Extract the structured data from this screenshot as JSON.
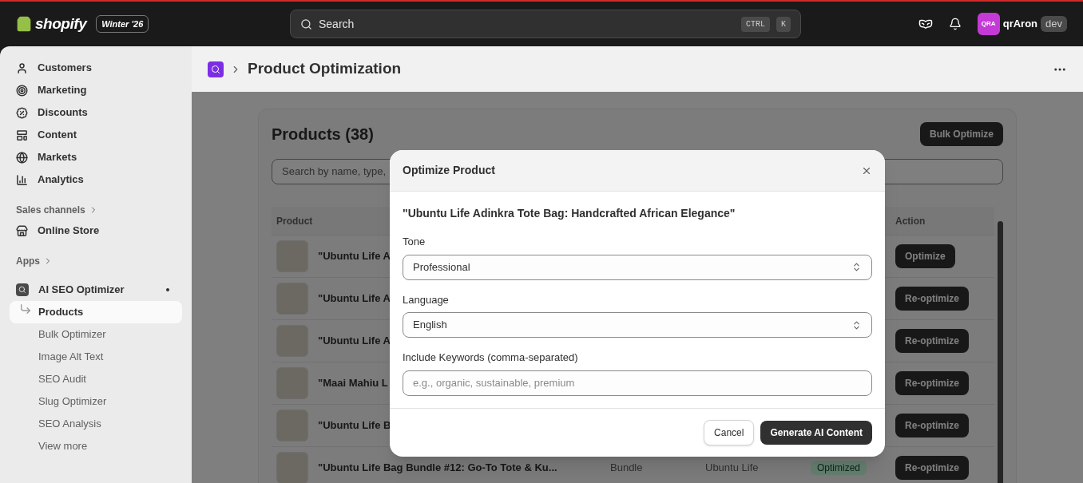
{
  "topbar": {
    "brand": "shopify",
    "edition_badge": "Winter '26",
    "search": {
      "placeholder": "Search",
      "shortcut_keys": [
        "CTRL",
        "K"
      ]
    },
    "user": {
      "initials": "QRA",
      "name": "qrAron",
      "role_badge": "dev"
    }
  },
  "sidebar": {
    "items": [
      {
        "label": "Customers"
      },
      {
        "label": "Marketing"
      },
      {
        "label": "Discounts"
      },
      {
        "label": "Content"
      },
      {
        "label": "Markets"
      },
      {
        "label": "Analytics"
      }
    ],
    "sales_channels": {
      "heading": "Sales channels",
      "items": [
        {
          "label": "Online Store"
        }
      ]
    },
    "apps": {
      "heading": "Apps",
      "app": {
        "label": "AI SEO Optimizer",
        "children": [
          {
            "label": "Products",
            "selected": true
          },
          {
            "label": "Bulk Optimizer",
            "selected": false
          },
          {
            "label": "Image Alt Text",
            "selected": false
          },
          {
            "label": "SEO Audit",
            "selected": false
          },
          {
            "label": "Slug Optimizer",
            "selected": false
          },
          {
            "label": "SEO Analysis",
            "selected": false
          }
        ]
      },
      "more": "View more"
    }
  },
  "page_header": {
    "title": "Product Optimization"
  },
  "products_card": {
    "title": "Products (38)",
    "bulk_button": "Bulk Optimize",
    "search": {
      "placeholder": "Search by name, type,"
    },
    "table": {
      "columns": {
        "product": "Product",
        "action": "Action"
      },
      "rows": [
        {
          "product": "\"Ubuntu Life A",
          "action": "Optimize"
        },
        {
          "product": "\"Ubuntu Life A",
          "action": "Re-optimize"
        },
        {
          "product": "\"Ubuntu Life A",
          "action": "Re-optimize"
        },
        {
          "product": "\"Maai Mahiu L",
          "action": "Re-optimize"
        },
        {
          "product": "\"Ubuntu Life B",
          "action": "Re-optimize"
        },
        {
          "product": "\"Ubuntu Life Bag Bundle #12: Go-To Tote & Ku...",
          "type": "Bundle",
          "vendor": "Ubuntu Life",
          "status": "Optimized",
          "action": "Re-optimize"
        }
      ]
    }
  },
  "modal": {
    "title": "Optimize Product",
    "product_title": "\"Ubuntu Life Adinkra Tote Bag: Handcrafted African Elegance\"",
    "fields": [
      {
        "kind": "select",
        "label": "Tone",
        "value": "Professional"
      },
      {
        "kind": "select",
        "label": "Language",
        "value": "English"
      },
      {
        "kind": "text",
        "label": "Include Keywords (comma-separated)",
        "placeholder": "e.g., organic, sustainable, premium"
      }
    ],
    "cancel_button": "Cancel",
    "submit_button": "Generate AI Content"
  }
}
